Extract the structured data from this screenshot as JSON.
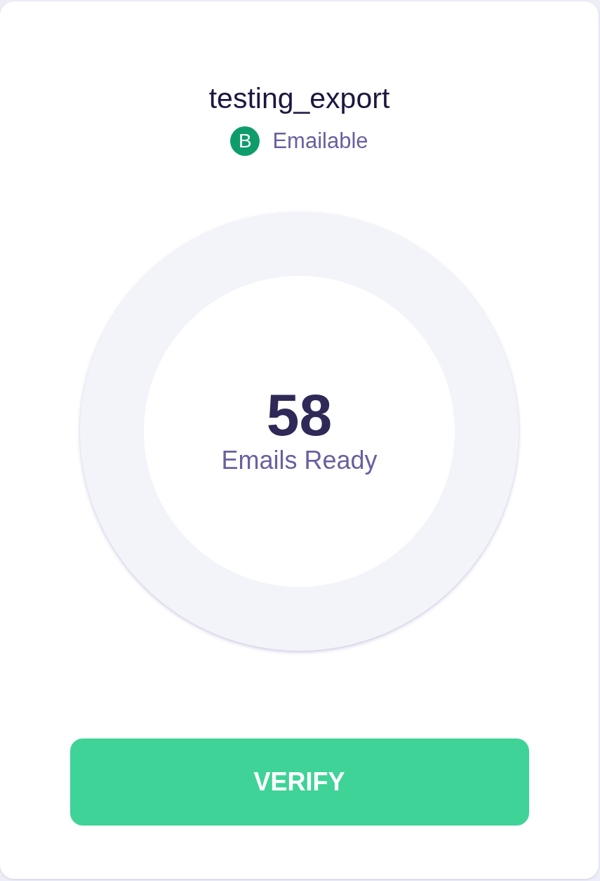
{
  "list": {
    "title": "testing_export",
    "status": {
      "icon_letter": "B",
      "label": "Emailable"
    }
  },
  "summary": {
    "count": "58",
    "caption": "Emails Ready"
  },
  "buttons": [
    {
      "label": "VERIFY",
      "kind": "primary"
    }
  ]
}
